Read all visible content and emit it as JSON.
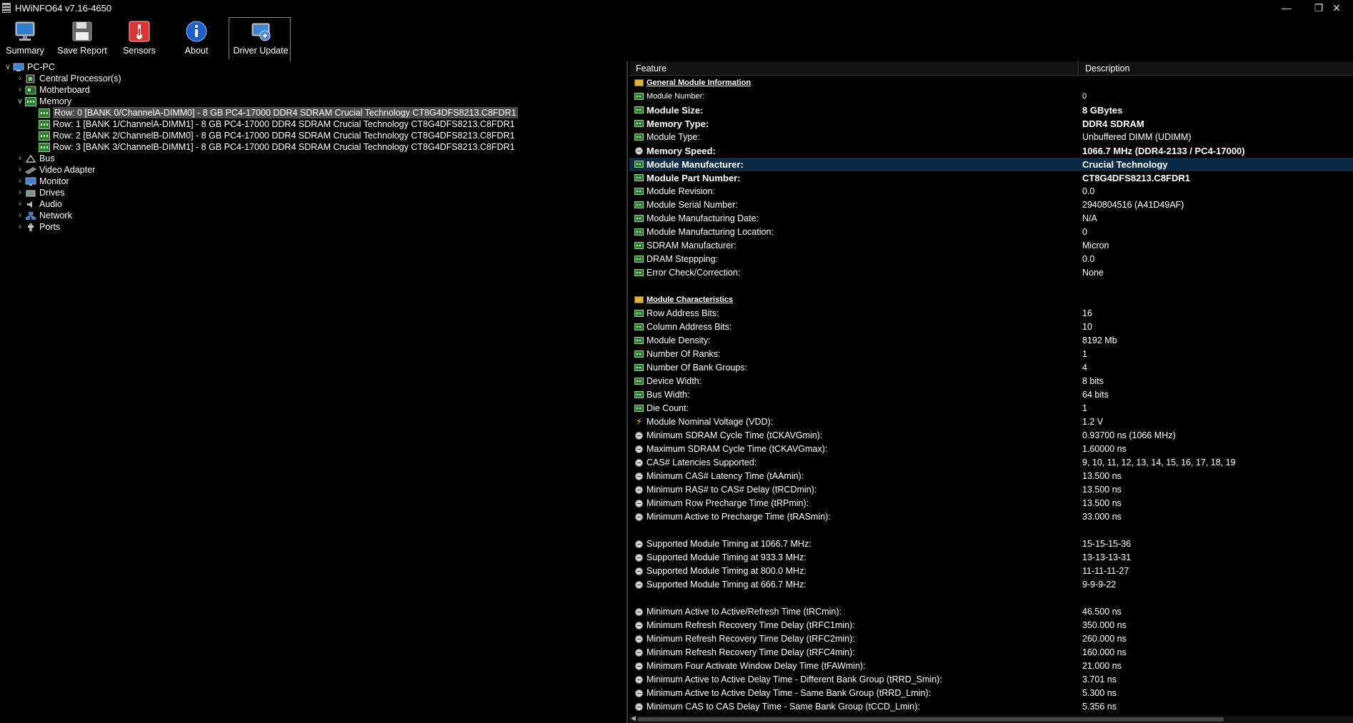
{
  "window": {
    "title": "HWiNFO64 v7.16-4650"
  },
  "toolbar": {
    "buttons": [
      {
        "label": "Summary"
      },
      {
        "label": "Save Report"
      },
      {
        "label": "Sensors"
      },
      {
        "label": "About"
      },
      {
        "label": "Driver Update"
      }
    ]
  },
  "tree": {
    "root": "PC-PC",
    "items": [
      "Central Processor(s)",
      "Motherboard",
      "Memory",
      "Row: 0 [BANK 0/ChannelA-DIMM0] - 8 GB PC4-17000 DDR4 SDRAM Crucial Technology CT8G4DFS8213.C8FDR1",
      "Row: 1 [BANK 1/ChannelA-DIMM1] - 8 GB PC4-17000 DDR4 SDRAM Crucial Technology CT8G4DFS8213.C8FDR1",
      "Row: 2 [BANK 2/ChannelB-DIMM0] - 8 GB PC4-17000 DDR4 SDRAM Crucial Technology CT8G4DFS8213.C8FDR1",
      "Row: 3 [BANK 3/ChannelB-DIMM1] - 8 GB PC4-17000 DDR4 SDRAM Crucial Technology CT8G4DFS8213.C8FDR1",
      "Bus",
      "Video Adapter",
      "Monitor",
      "Drives",
      "Audio",
      "Network",
      "Ports"
    ]
  },
  "list": {
    "col_feature": "Feature",
    "col_description": "Description",
    "rows": [
      {
        "f": "General Module Information",
        "v": ""
      },
      {
        "f": "Module Number:",
        "v": "0"
      },
      {
        "f": "Module Size:",
        "v": "8 GBytes"
      },
      {
        "f": "Memory Type:",
        "v": "DDR4 SDRAM"
      },
      {
        "f": "Module Type:",
        "v": "Unbuffered DIMM (UDIMM)"
      },
      {
        "f": "Memory Speed:",
        "v": "1066.7 MHz (DDR4-2133 / PC4-17000)"
      },
      {
        "f": "Module Manufacturer:",
        "v": "Crucial Technology"
      },
      {
        "f": "Module Part Number:",
        "v": "CT8G4DFS8213.C8FDR1"
      },
      {
        "f": "Module Revision:",
        "v": "0.0"
      },
      {
        "f": "Module Serial Number:",
        "v": "2940804516 (A41D49AF)"
      },
      {
        "f": "Module Manufacturing Date:",
        "v": "N/A"
      },
      {
        "f": "Module Manufacturing Location:",
        "v": "0"
      },
      {
        "f": "SDRAM Manufacturer:",
        "v": "Micron"
      },
      {
        "f": "DRAM Steppping:",
        "v": "0.0"
      },
      {
        "f": "Error Check/Correction:",
        "v": "None"
      },
      {
        "f": "Module Characteristics",
        "v": ""
      },
      {
        "f": "Row Address Bits:",
        "v": "16"
      },
      {
        "f": "Column Address Bits:",
        "v": "10"
      },
      {
        "f": "Module Density:",
        "v": "8192 Mb"
      },
      {
        "f": "Number Of Ranks:",
        "v": "1"
      },
      {
        "f": "Number Of Bank Groups:",
        "v": "4"
      },
      {
        "f": "Device Width:",
        "v": "8 bits"
      },
      {
        "f": "Bus Width:",
        "v": "64 bits"
      },
      {
        "f": "Die Count:",
        "v": "1"
      },
      {
        "f": "Module Nominal Voltage (VDD):",
        "v": "1.2 V"
      },
      {
        "f": "Minimum SDRAM Cycle Time (tCKAVGmin):",
        "v": "0.93700 ns (1066 MHz)"
      },
      {
        "f": "Maximum SDRAM Cycle Time (tCKAVGmax):",
        "v": "1.60000 ns"
      },
      {
        "f": "CAS# Latencies Supported:",
        "v": "9, 10, 11, 12, 13, 14, 15, 16, 17, 18, 19"
      },
      {
        "f": "Minimum CAS# Latency Time (tAAmin):",
        "v": "13.500 ns"
      },
      {
        "f": "Minimum RAS# to CAS# Delay (tRCDmin):",
        "v": "13.500 ns"
      },
      {
        "f": "Minimum Row Precharge Time (tRPmin):",
        "v": "13.500 ns"
      },
      {
        "f": "Minimum Active to Precharge Time (tRASmin):",
        "v": "33.000 ns"
      },
      {
        "f": "Supported Module Timing at 1066.7 MHz:",
        "v": "15-15-15-36"
      },
      {
        "f": "Supported Module Timing at 933.3 MHz:",
        "v": "13-13-13-31"
      },
      {
        "f": "Supported Module Timing at 800.0 MHz:",
        "v": "11-11-11-27"
      },
      {
        "f": "Supported Module Timing at 666.7 MHz:",
        "v": "9-9-9-22"
      },
      {
        "f": "Minimum Active to Active/Refresh Time (tRCmin):",
        "v": "46.500 ns"
      },
      {
        "f": "Minimum Refresh Recovery Time Delay (tRFC1min):",
        "v": "350.000 ns"
      },
      {
        "f": "Minimum Refresh Recovery Time Delay (tRFC2min):",
        "v": "260.000 ns"
      },
      {
        "f": "Minimum Refresh Recovery Time Delay (tRFC4min):",
        "v": "160.000 ns"
      },
      {
        "f": "Minimum Four Activate Window Delay Time (tFAWmin):",
        "v": "21.000 ns"
      },
      {
        "f": "Minimum Active to Active Delay Time - Different Bank Group (tRRD_Smin):",
        "v": "3.701 ns"
      },
      {
        "f": "Minimum Active to Active Delay Time - Same Bank Group (tRRD_Lmin):",
        "v": "5.300 ns"
      },
      {
        "f": "Minimum CAS to CAS Delay Time - Same Bank Group (tCCD_Lmin):",
        "v": "5.356 ns"
      }
    ]
  }
}
